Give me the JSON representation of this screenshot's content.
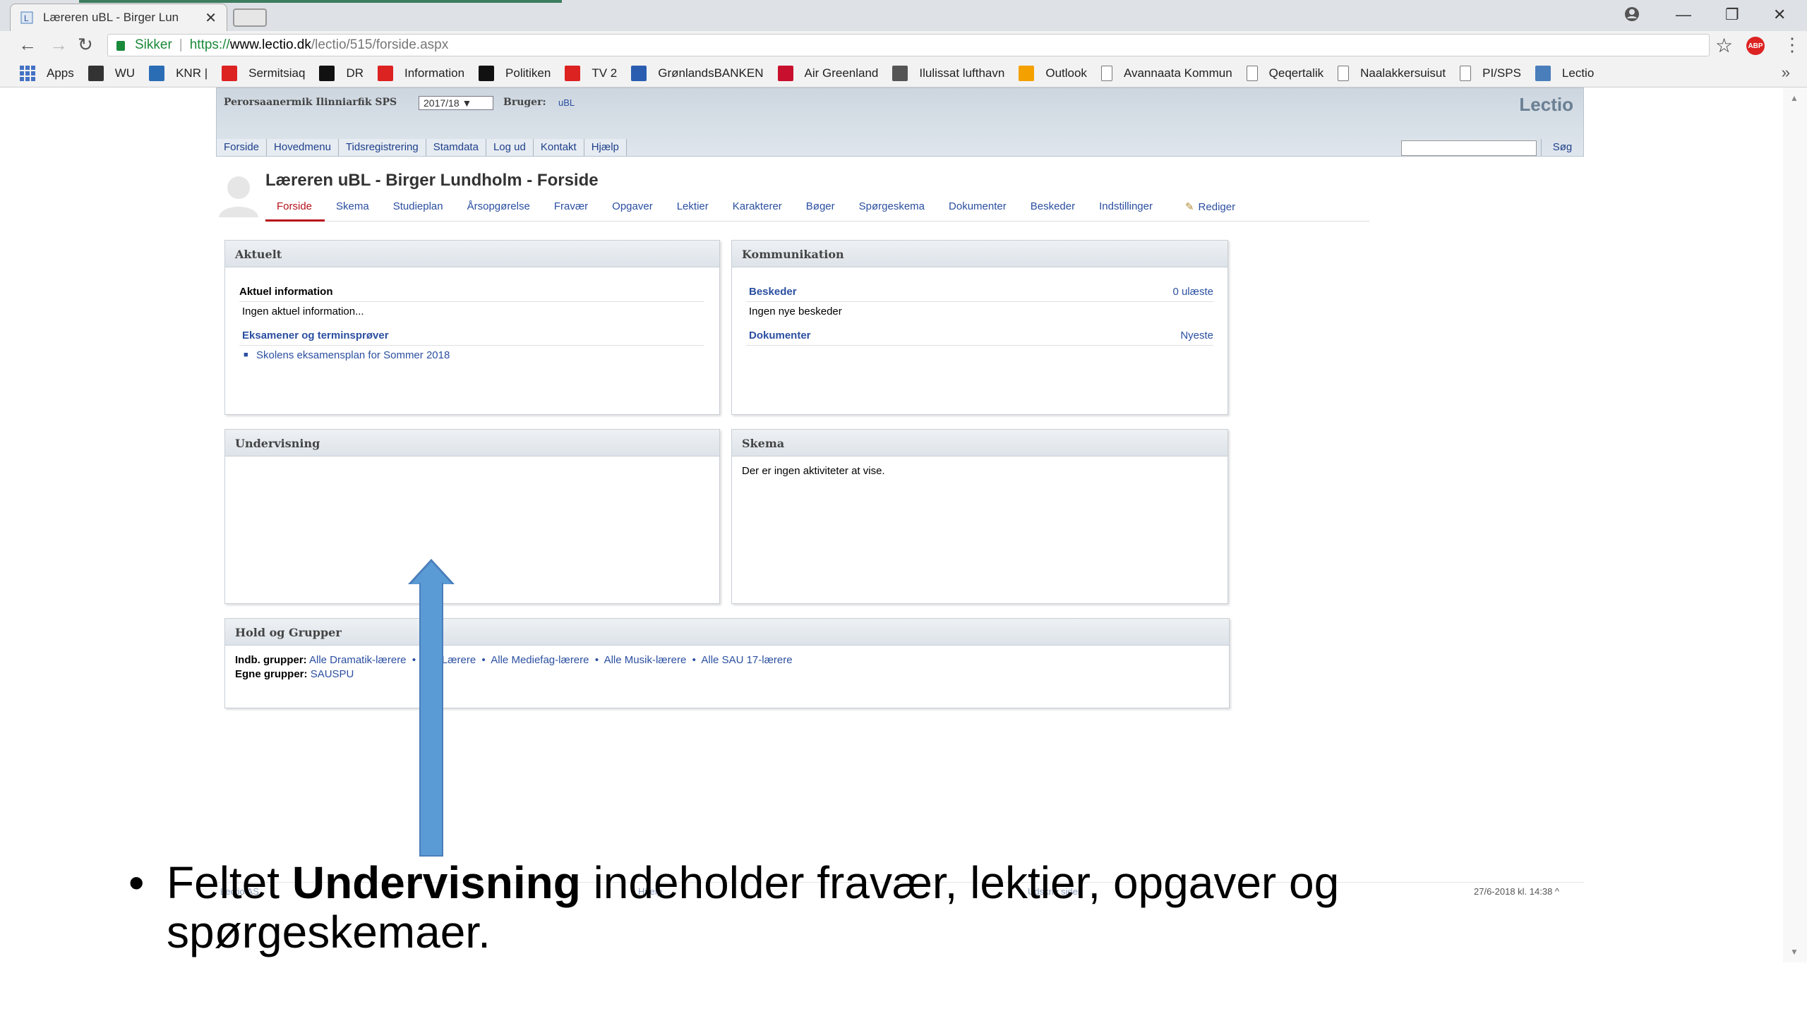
{
  "browser": {
    "tab_title": "Læreren uBL - Birger Lun",
    "tab_close": "✕",
    "url_secure": "Sikker",
    "url_scheme": "https://",
    "url_domain": "www.lectio.dk",
    "url_path": "/lectio/515/forside.aspx",
    "bookmarks": [
      {
        "label": "Apps",
        "icon": "apps-grid-icon",
        "color": "#4472c4"
      },
      {
        "label": "WU",
        "icon": "wu-icon",
        "color": "#333"
      },
      {
        "label": "KNR |",
        "icon": "knr-icon",
        "color": "#2a6db5"
      },
      {
        "label": "Sermitsiaq",
        "icon": "sermitsiaq-icon",
        "color": "#d22"
      },
      {
        "label": "DR",
        "icon": "dr-icon",
        "color": "#111"
      },
      {
        "label": "Information",
        "icon": "information-icon",
        "color": "#d22"
      },
      {
        "label": "Politiken",
        "icon": "politiken-icon",
        "color": "#111"
      },
      {
        "label": "TV 2",
        "icon": "tv2-icon",
        "color": "#d22"
      },
      {
        "label": "GrønlandsBANKEN",
        "icon": "gronlandsbanken-icon",
        "color": "#2a5db0"
      },
      {
        "label": "Air Greenland",
        "icon": "air-greenland-icon",
        "color": "#c8102e"
      },
      {
        "label": "Ilulissat lufthavn",
        "icon": "airport-icon",
        "color": "#555"
      },
      {
        "label": "Outlook",
        "icon": "outlook-icon",
        "color": "#f4a100"
      },
      {
        "label": "Avannaata Kommun",
        "icon": "page-icon",
        "color": "#888"
      },
      {
        "label": "Qeqertalik",
        "icon": "page-icon",
        "color": "#888"
      },
      {
        "label": "Naalakkersuisut",
        "icon": "page-icon",
        "color": "#888"
      },
      {
        "label": "PI/SPS",
        "icon": "page-icon",
        "color": "#888"
      },
      {
        "label": "Lectio",
        "icon": "lectio-icon",
        "color": "#4a7ebb"
      }
    ],
    "more": "»"
  },
  "header": {
    "school": "Perorsaanermik Ilinniarfik SPS",
    "year": "2017/18 ▼",
    "user_label": "Bruger:",
    "user_value": "uBL",
    "brand": "Lectio",
    "menu": [
      "Forside",
      "Hovedmenu",
      "Tidsregistrering",
      "Stamdata",
      "Log ud",
      "Kontakt",
      "Hjælp"
    ],
    "search_button": "Søg"
  },
  "page": {
    "title": "Læreren uBL - Birger Lundholm - Forside",
    "subnav": [
      "Forside",
      "Skema",
      "Studieplan",
      "Årsopgørelse",
      "Fravær",
      "Opgaver",
      "Lektier",
      "Karakterer",
      "Bøger",
      "Spørgeskema",
      "Dokumenter",
      "Beskeder",
      "Indstillinger"
    ],
    "edit": "Rediger"
  },
  "panels": {
    "aktuelt": {
      "title": "Aktuelt",
      "info_heading": "Aktuel information",
      "info_text": "Ingen aktuel information...",
      "exams_link": "Eksamener og terminsprøver",
      "exam_item": "Skolens eksamensplan for Sommer 2018"
    },
    "kommunikation": {
      "title": "Kommunikation",
      "messages_link": "Beskeder",
      "messages_count": "0 ulæste",
      "messages_text": "Ingen nye beskeder",
      "documents_link": "Dokumenter",
      "documents_right": "Nyeste"
    },
    "undervisning": {
      "title": "Undervisning"
    },
    "skema": {
      "title": "Skema",
      "text": "Der er ingen aktiviteter at vise."
    },
    "hold": {
      "title": "Hold og Grupper",
      "indb_label": "Indb. grupper:",
      "indb_groups": [
        "Alle Dramatik-lærere",
        "Alle Lærere",
        "Alle Mediefag-lærere",
        "Alle Musik-lærere",
        "Alle SAU 17-lærere"
      ],
      "egne_label": "Egne grupper:",
      "egne_groups": "SAUSPU"
    }
  },
  "footer": {
    "left": "Lectio AS",
    "mid": "Hjælp",
    "right": "Udskriv siden",
    "date": "27/6-2018  kl. 14:38  ^"
  },
  "caption": {
    "bullet": "•",
    "pre": "Feltet ",
    "bold": "Undervisning",
    "post": " indeholder fravær, lektier, opgaver og spørgeskemaer."
  }
}
